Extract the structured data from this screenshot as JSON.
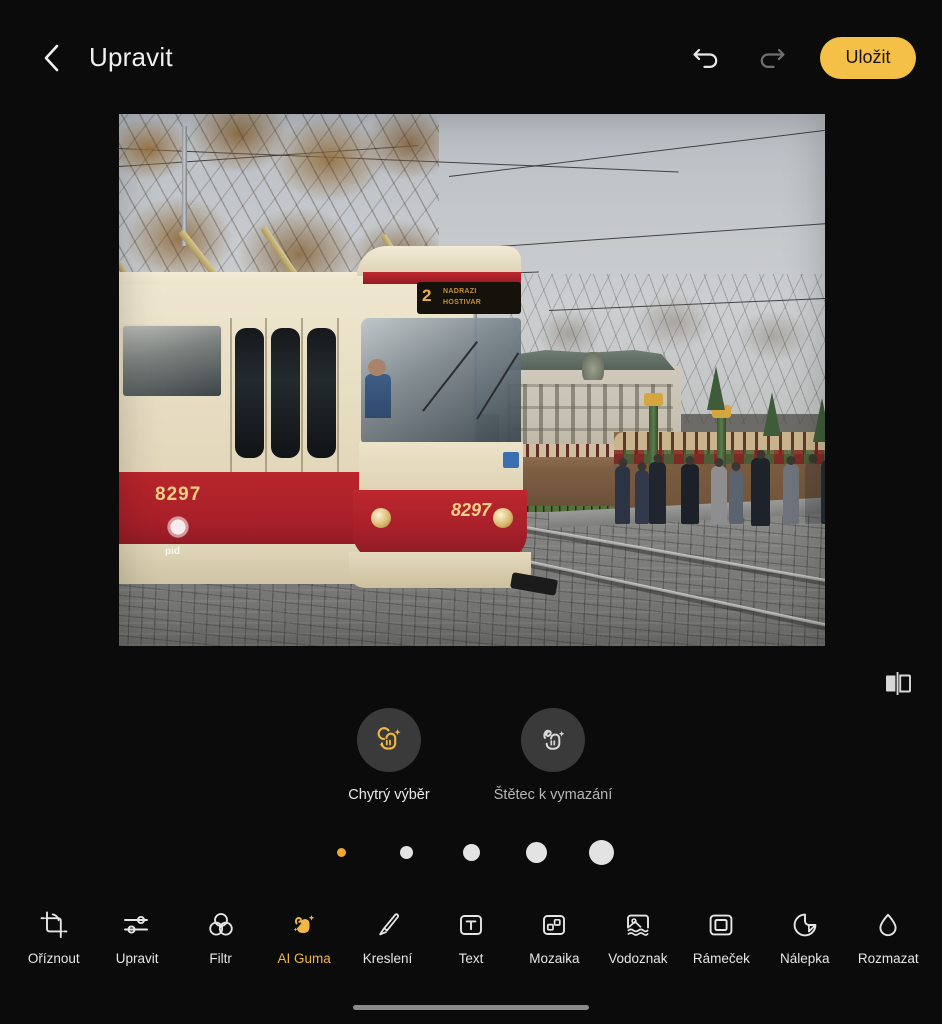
{
  "app": {
    "background_color": "#0b0b0b",
    "accent_color": "#f5c048",
    "text_color": "#f0f0f0"
  },
  "header": {
    "back_icon": "chevron-left-icon",
    "title": "Upravit",
    "undo_icon": "undo-arrow-icon",
    "redo_icon": "redo-arrow-icon",
    "save_label": "Uložit"
  },
  "canvas": {
    "compare_icon": "before-after-compare-icon",
    "photo": {
      "description": "Prague tram on cobblestone street with Christmas market",
      "tram_side_number": "8297",
      "tram_front_number": "8297",
      "tram_operator": "pid",
      "route_number": "2",
      "destination_line1": "NADRAZI",
      "destination_line2": "HOSTIVAR"
    }
  },
  "subtools": [
    {
      "label": "Chytrý výběr",
      "icon": "smart-select-icon",
      "active": true
    },
    {
      "label": "Štětec k vymazání",
      "icon": "erase-brush-icon",
      "active": false
    }
  ],
  "dots": {
    "active_index": 0,
    "active_color": "#f0a830",
    "inactive_color": "#e3e3e3",
    "sizes": [
      9,
      13,
      17,
      21,
      25
    ]
  },
  "toolbar": [
    {
      "label": "Oříznout",
      "icon": "crop-icon",
      "active": false
    },
    {
      "label": "Upravit",
      "icon": "sliders-icon",
      "active": false
    },
    {
      "label": "Filtr",
      "icon": "filter-circles-icon",
      "active": false
    },
    {
      "label": "AI Guma",
      "icon": "ai-eraser-icon",
      "active": true
    },
    {
      "label": "Kreslení",
      "icon": "brush-icon",
      "active": false
    },
    {
      "label": "Text",
      "icon": "text-box-icon",
      "active": false
    },
    {
      "label": "Mozaika",
      "icon": "mosaic-icon",
      "active": false
    },
    {
      "label": "Vodoznak",
      "icon": "watermark-icon",
      "active": false
    },
    {
      "label": "Rámeček",
      "icon": "frame-icon",
      "active": false
    },
    {
      "label": "Nálepka",
      "icon": "sticker-icon",
      "active": false
    },
    {
      "label": "Rozmazat",
      "icon": "blur-drop-icon",
      "active": false
    }
  ],
  "system": {
    "home_indicator": "home-indicator-bar"
  }
}
